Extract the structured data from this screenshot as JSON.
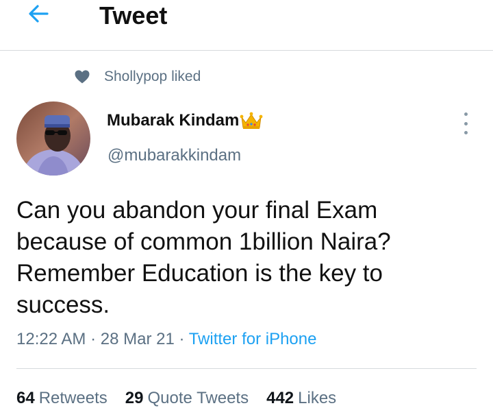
{
  "header": {
    "title": "Tweet",
    "back_icon": "arrow-left-icon",
    "accent_color": "#1da1f2"
  },
  "social_context": {
    "icon": "heart-icon",
    "text": "Shollypop liked"
  },
  "tweet": {
    "author_name": "Mubarak Kindam",
    "author_badge": "crown-emoji",
    "handle": "@mubarakkindam",
    "more_icon": "more-vertical-icon",
    "text": "Can you abandon your final Exam because of common 1billion Naira? Remember Education is the key to success.",
    "time": "12:22 AM",
    "separator": "·",
    "date": "28 Mar 21",
    "source": "Twitter for iPhone"
  },
  "stats": {
    "retweets_count": "64",
    "retweets_label": "Retweets",
    "quotes_count": "29",
    "quotes_label": "Quote Tweets",
    "likes_count": "442",
    "likes_label": "Likes"
  }
}
